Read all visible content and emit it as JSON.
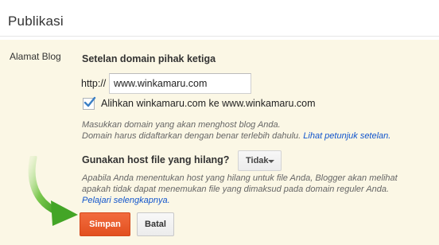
{
  "section": {
    "title": "Publikasi"
  },
  "row": {
    "label": "Alamat Blog"
  },
  "domain": {
    "heading": "Setelan domain pihak ketiga",
    "prefix": "http://",
    "value": "www.winkamaru.com",
    "redirect_checked": true,
    "redirect_label": "Alihkan winkamaru.com ke www.winkamaru.com",
    "help_line1": "Masukkan domain yang akan menghost blog Anda.",
    "help_line2": "Domain harus didaftarkan dengan benar terlebih dahulu.",
    "help_link": "Lihat petunjuk setelan."
  },
  "missing_files": {
    "label": "Gunakan host file yang hilang?",
    "selected": "Tidak",
    "help_line1": "Apabila Anda menentukan host yang hilang untuk file Anda, Blogger akan melihat",
    "help_line2": "apakah tidak dapat menemukan file yang dimaksud pada domain reguler Anda.",
    "help_link": "Pelajari selengkapnya."
  },
  "actions": {
    "save": "Simpan",
    "cancel": "Batal"
  },
  "colors": {
    "panel_bg": "#fbf7e5",
    "save_button": "#e8592a",
    "link": "#1155cc",
    "arrow": "#4caf2f"
  },
  "icons": {
    "checkbox": "checkmark-icon",
    "dropdown": "caret-down-icon",
    "pointer": "green-arrow-icon"
  }
}
